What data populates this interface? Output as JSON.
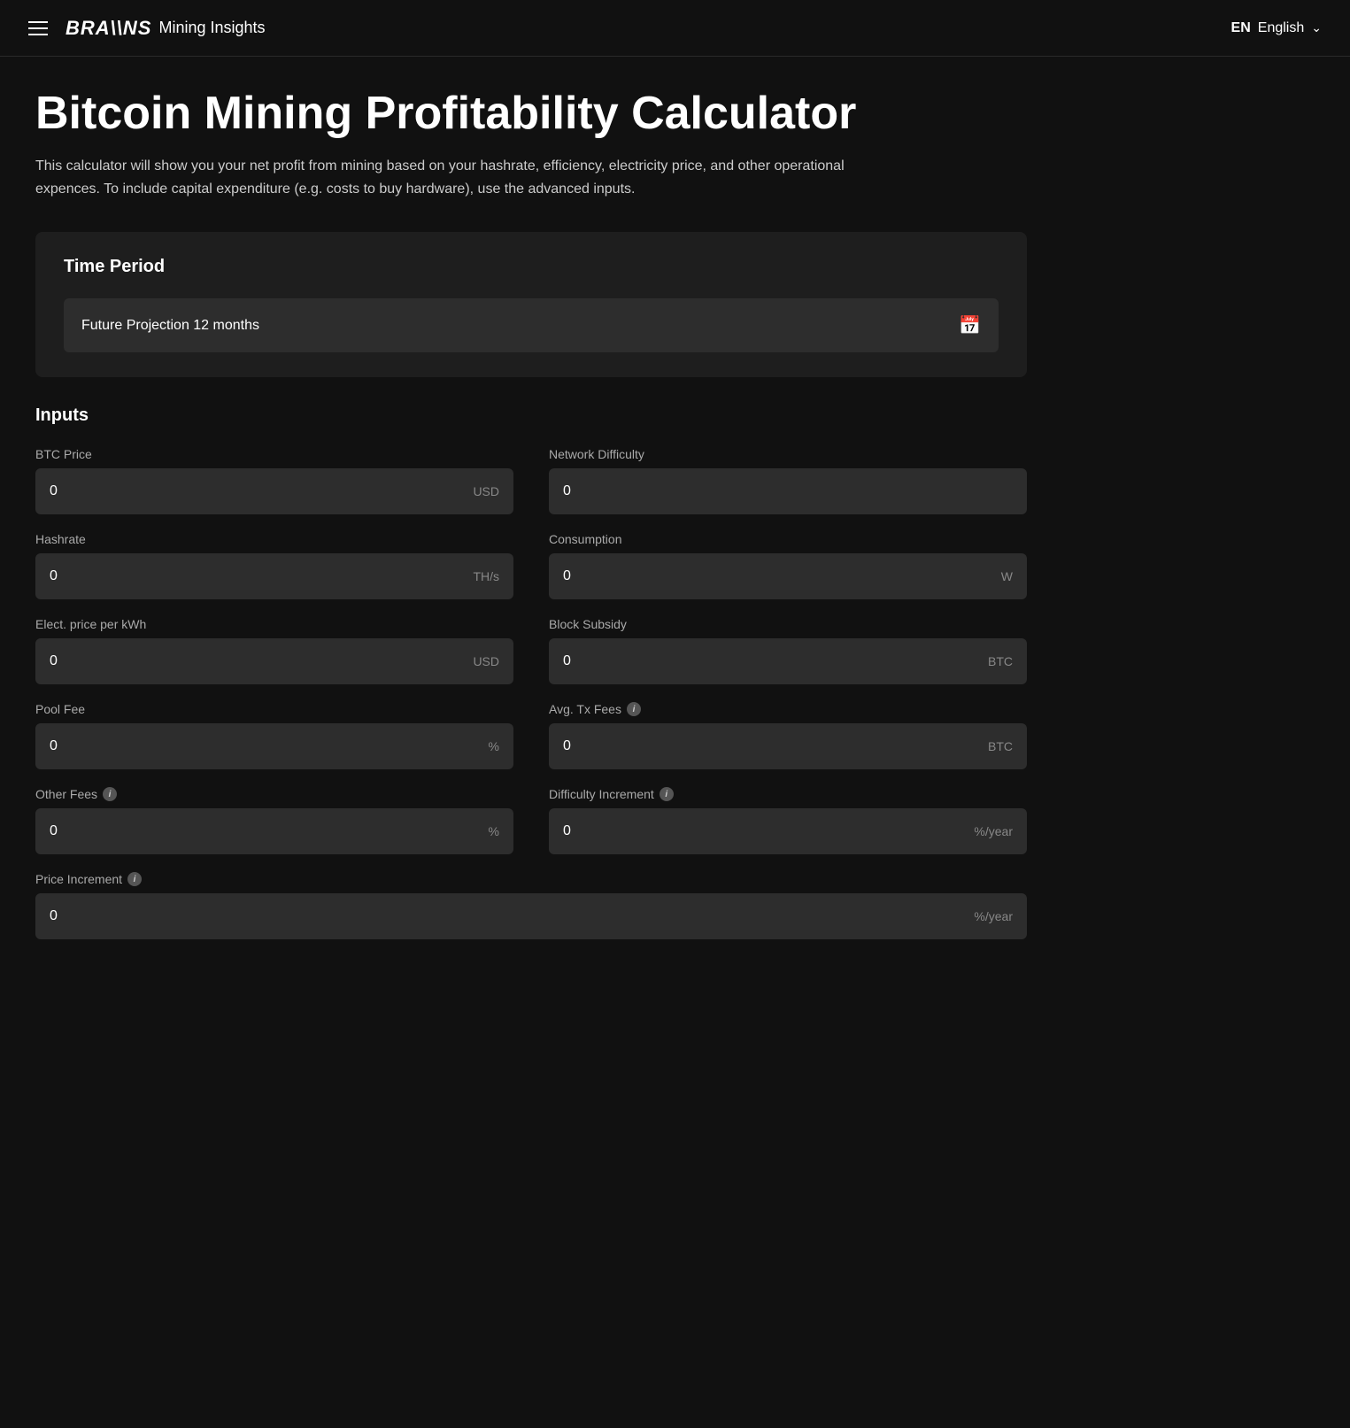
{
  "header": {
    "menu_label": "Menu",
    "logo_brains": "BRA\\\\NS",
    "logo_subtitle": "Mining Insights",
    "lang_code": "EN",
    "lang_label": "English",
    "chevron": "∨"
  },
  "page": {
    "title": "Bitcoin Mining Profitability Calculator",
    "description": "This calculator will show you your net profit from mining based on your hashrate, efficiency, electricity price, and other operational expences. To include capital expenditure (e.g. costs to buy hardware), use the advanced inputs."
  },
  "time_period": {
    "section_title": "Time Period",
    "selected_value": "Future Projection 12 months",
    "calendar_icon": "📅"
  },
  "inputs": {
    "section_title": "Inputs",
    "fields": [
      {
        "id": "btc-price",
        "label": "BTC Price",
        "value": "0",
        "unit": "USD",
        "has_info": false,
        "full_width": false
      },
      {
        "id": "network-difficulty",
        "label": "Network Difficulty",
        "value": "0",
        "unit": "",
        "has_info": false,
        "full_width": false
      },
      {
        "id": "hashrate",
        "label": "Hashrate",
        "value": "0",
        "unit": "TH/s",
        "has_info": false,
        "full_width": false
      },
      {
        "id": "consumption",
        "label": "Consumption",
        "value": "0",
        "unit": "W",
        "has_info": false,
        "full_width": false
      },
      {
        "id": "elect-price",
        "label": "Elect. price per kWh",
        "value": "0",
        "unit": "USD",
        "has_info": false,
        "full_width": false
      },
      {
        "id": "block-subsidy",
        "label": "Block Subsidy",
        "value": "0",
        "unit": "BTC",
        "has_info": false,
        "full_width": false
      },
      {
        "id": "pool-fee",
        "label": "Pool Fee",
        "value": "0",
        "unit": "%",
        "has_info": false,
        "full_width": false
      },
      {
        "id": "avg-tx-fees",
        "label": "Avg. Tx Fees",
        "value": "0",
        "unit": "BTC",
        "has_info": true,
        "full_width": false
      },
      {
        "id": "other-fees",
        "label": "Other Fees",
        "value": "0",
        "unit": "%",
        "has_info": true,
        "full_width": false
      },
      {
        "id": "difficulty-increment",
        "label": "Difficulty Increment",
        "value": "0",
        "unit": "%/year",
        "has_info": true,
        "full_width": false
      },
      {
        "id": "price-increment",
        "label": "Price Increment",
        "value": "0",
        "unit": "%/year",
        "has_info": true,
        "full_width": true
      }
    ],
    "info_symbol": "i"
  }
}
